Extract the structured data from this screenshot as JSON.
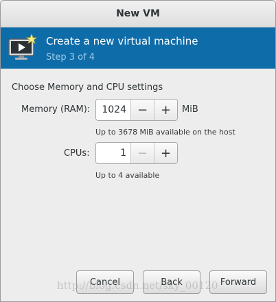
{
  "window": {
    "title": "New VM"
  },
  "header": {
    "title": "Create a new virtual machine",
    "step": "Step 3 of 4",
    "icon": "monitor-with-star-icon"
  },
  "section": {
    "title": "Choose Memory and CPU settings"
  },
  "memory": {
    "label": "Memory (RAM):",
    "value": "1024",
    "unit": "MiB",
    "hint": "Up to 3678 MiB available on the host",
    "decrement": "−",
    "increment": "+"
  },
  "cpus": {
    "label": "CPUs:",
    "value": "1",
    "hint": "Up to 4 available",
    "decrement": "−",
    "increment": "+"
  },
  "buttons": {
    "cancel": "Cancel",
    "back": "Back",
    "forward": "Forward"
  },
  "watermark": "http://blog.csdn.net/sky_00120",
  "colors": {
    "banner": "#0e6ca9",
    "step_text": "#9ccbe8"
  }
}
